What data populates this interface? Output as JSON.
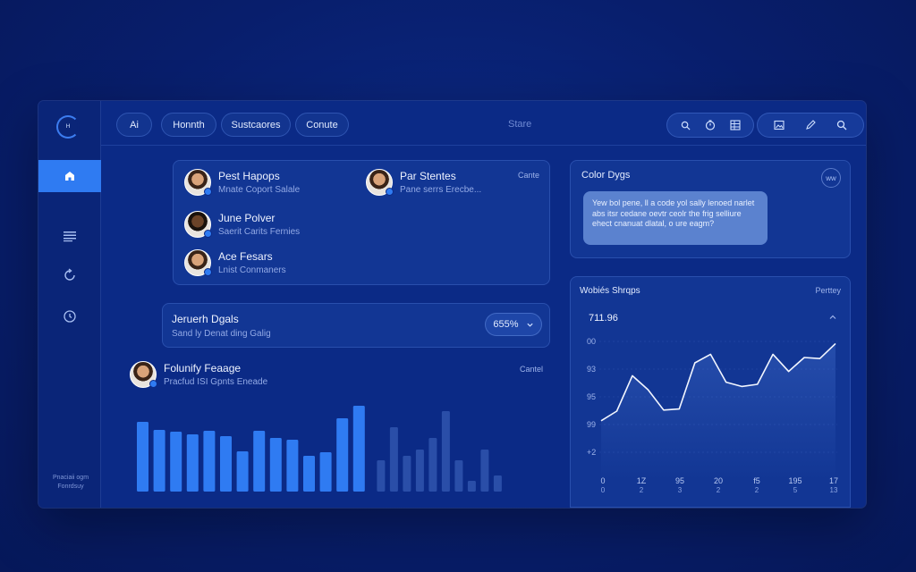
{
  "sidebar": {
    "logo_text": "ᴴ",
    "items": [
      {
        "icon": "home-icon",
        "active": true
      },
      {
        "icon": "list-icon",
        "active": false
      },
      {
        "icon": "refresh-icon",
        "active": false
      },
      {
        "icon": "clock-icon",
        "active": false
      }
    ],
    "footer": "Pnaciaii ogm Fonrdsuy"
  },
  "topbar": {
    "tabs": [
      {
        "label": "Ai"
      },
      {
        "label": "Honnth"
      },
      {
        "label": "Sustcaores"
      },
      {
        "label": "Conute"
      }
    ],
    "center_label": "Stare",
    "icons_left": [
      "search-icon",
      "timer-icon",
      "grid-icon"
    ],
    "icons_right": [
      "image-icon",
      "pen-icon",
      "search-icon"
    ]
  },
  "contacts_card": {
    "contacts": [
      {
        "name": "Pest Hapops",
        "sub": "Mnate Coport Salale"
      },
      {
        "name": "Par Stentes",
        "sub": "Pane serrs Erecbe..."
      },
      {
        "name": "June Polver",
        "sub": "Saerit Carits Fernies"
      },
      {
        "name": "Ace Fesars",
        "sub": "Lnist Conmaners"
      }
    ],
    "link": "Cante"
  },
  "chat_card": {
    "title": "Color Dygs",
    "badge": "ww",
    "message": "Yew bol pene, ll a code yol sally lenoed narlet abs itsr cedane oevtr ceolr the frig selliure ehect cnanuat dlatal, o ure eagm?"
  },
  "deals_card": {
    "title": "Jeruerh Dgals",
    "sub": "Sand ly Denat ding Galig",
    "percent": "655%"
  },
  "activity": {
    "name": "Folunify Feaage",
    "sub": "Pracfud ISI Gpnts Eneade",
    "link": "Cantel",
    "bars_primary": [
      0.78,
      0.69,
      0.67,
      0.64,
      0.68,
      0.62,
      0.45,
      0.68,
      0.6,
      0.58,
      0.4,
      0.44,
      0.82,
      0.96
    ],
    "bars_secondary": [
      0.35,
      0.72,
      0.4,
      0.47,
      0.6,
      0.9,
      0.35,
      0.12,
      0.47,
      0.18
    ]
  },
  "chart_card": {
    "title": "Wobiés Shrqps",
    "link": "Perttey",
    "value": "711.96"
  },
  "chart_data": {
    "type": "line",
    "x": [
      0,
      1,
      2,
      3,
      4,
      5,
      6,
      7,
      8,
      9,
      10,
      11,
      12,
      13,
      14,
      15,
      16,
      17
    ],
    "xtick_labels": [
      "0 0",
      "1Z 2",
      "95 3",
      "20 2",
      "f5 2",
      "195 5",
      "17 13"
    ],
    "ytick_labels": [
      "00",
      "93",
      "95",
      "99",
      "+2"
    ],
    "series": [
      {
        "values": [
          16,
          25,
          58,
          45,
          26,
          27,
          70,
          78,
          52,
          48,
          50,
          78,
          62,
          75,
          74,
          88
        ]
      }
    ],
    "ylim": [
      0,
      100
    ],
    "grid": true
  },
  "colors": {
    "accent": "#2f7bf2",
    "bar_primary": "#2f7bf2",
    "bar_secondary": "#2a4ea8",
    "background": "#081e6c"
  }
}
